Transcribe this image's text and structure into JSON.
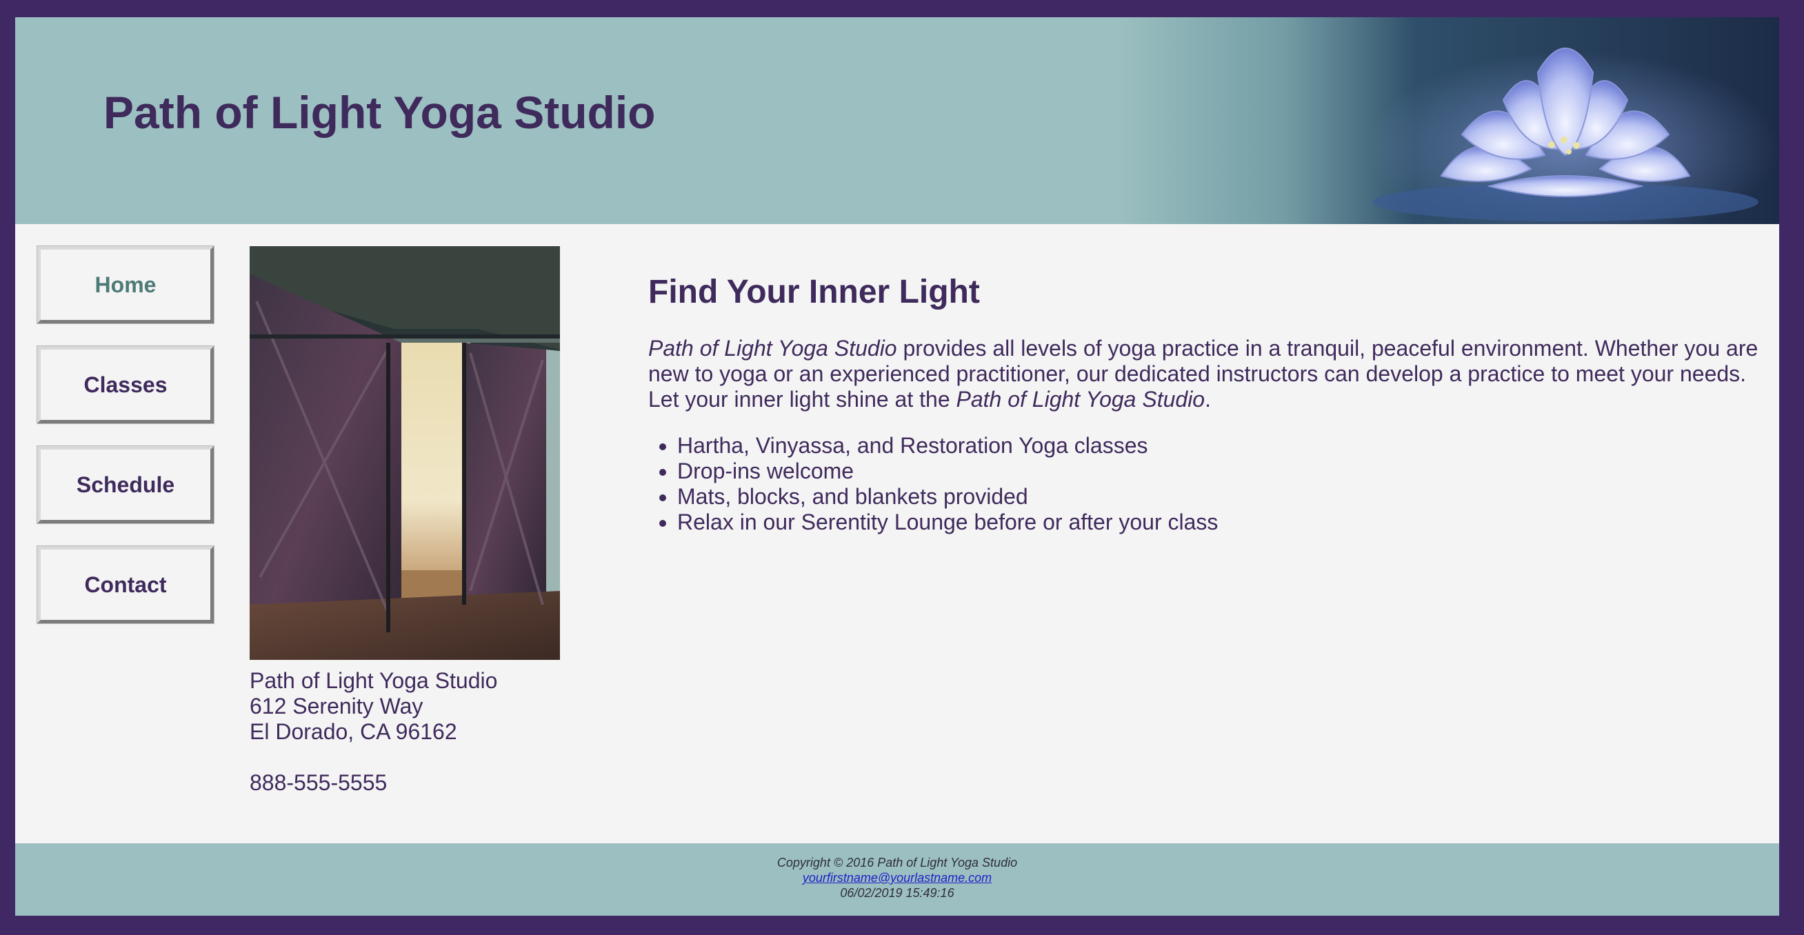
{
  "header": {
    "title": "Path of Light Yoga Studio"
  },
  "nav": {
    "items": [
      {
        "label": "Home",
        "active": true
      },
      {
        "label": "Classes",
        "active": false
      },
      {
        "label": "Schedule",
        "active": false
      },
      {
        "label": "Contact",
        "active": false
      }
    ]
  },
  "contact_info": {
    "name": "Path of Light Yoga Studio",
    "street": "612 Serenity Way",
    "city": "El Dorado, CA 96162",
    "phone": "888-555-5555"
  },
  "main": {
    "heading": "Find Your Inner Light",
    "intro_studio_name": "Path of Light Yoga Studio",
    "intro_text": " provides all levels of yoga practice in a tranquil, peaceful environment. Whether you are new to yoga or an experienced practitioner, our dedicated instructors can develop a practice to meet your needs. Let your inner light shine at the ",
    "intro_studio_name_end": "Path of Light Yoga Studio",
    "intro_end": ".",
    "features": [
      "Hartha, Vinyassa, and Restoration Yoga classes",
      "Drop-ins welcome",
      "Mats, blocks, and blankets provided",
      "Relax in our Serentity Lounge before or after your class"
    ]
  },
  "footer": {
    "copyright": "Copyright © 2016 Path of Light Yoga Studio",
    "email": "yourfirstname@yourlastname.com",
    "timestamp": "06/02/2019 15:49:16"
  },
  "colors": {
    "page_border": "#402864",
    "header_bg": "#9cc0c1",
    "content_bg": "#f4f4f4",
    "text": "#3f2a5c",
    "active_nav": "#4d7a78"
  },
  "icons": {
    "header_image": "lotus-flower-image",
    "photo": "sliding-barn-doors-photo"
  }
}
